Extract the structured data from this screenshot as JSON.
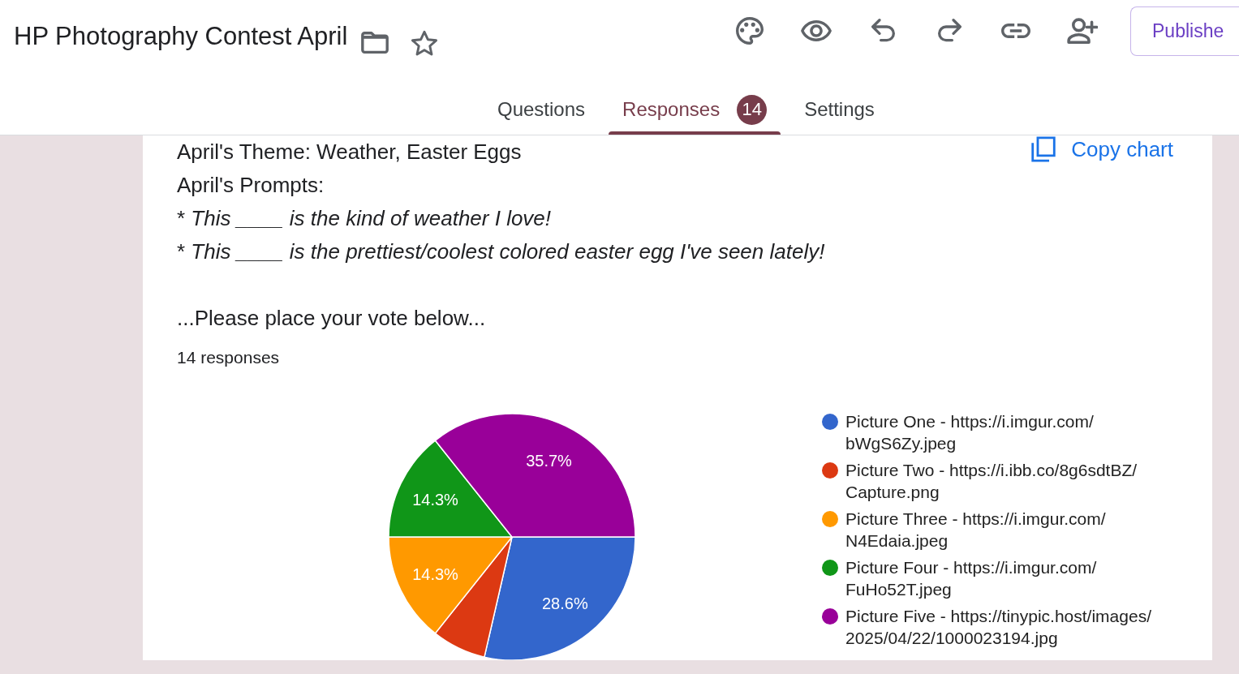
{
  "header": {
    "title": "HP Photography Contest April",
    "publish_button": {
      "label": "Publishe"
    }
  },
  "tabs": [
    {
      "label": "Questions",
      "selected": false
    },
    {
      "label": "Responses",
      "selected": true,
      "badge": "14"
    },
    {
      "label": "Settings",
      "selected": false
    }
  ],
  "question": {
    "paragraphs": [
      [
        {
          "kind": "plain",
          "text": "April's Theme: Weather, Easter Eggs"
        },
        {
          "kind": "plain",
          "text": "April's Prompts:"
        },
        {
          "kind": "prompt",
          "bullet": "*",
          "text": "This ____ is the kind of weather I love!"
        },
        {
          "kind": "prompt",
          "bullet": "*",
          "text": "This ____ is the prettiest/coolest colored easter egg I've seen lately!"
        }
      ],
      [
        {
          "kind": "plain",
          "text": "...Please place your vote below..."
        }
      ]
    ],
    "copy_button": {
      "label": "Copy chart"
    },
    "response_count": "14 responses",
    "chart_data": {
      "type": "pie",
      "categories": [
        "Picture One - https://i.imgur.com/\nbWgS6Zy.jpeg",
        "Picture Two - https://i.ibb.co/8g6sdtBZ/\nCapture.png",
        "Picture Three - https://i.imgur.com/\nN4Edaia.jpeg",
        "Picture Four - https://i.imgur.com/\nFuHo52T.jpeg",
        "Picture Five - https://tinypic.host/images/\n2025/04/22/1000023194.jpg"
      ],
      "values": [
        28.6,
        7.1,
        14.3,
        14.3,
        35.7
      ],
      "colors": [
        "#3366cc",
        "#dc3912",
        "#ff9900",
        "#109618",
        "#990099"
      ],
      "value_labels": [
        "28.6%",
        null,
        "14.3%",
        "14.3%",
        "35.7%"
      ],
      "legend": "right"
    }
  }
}
